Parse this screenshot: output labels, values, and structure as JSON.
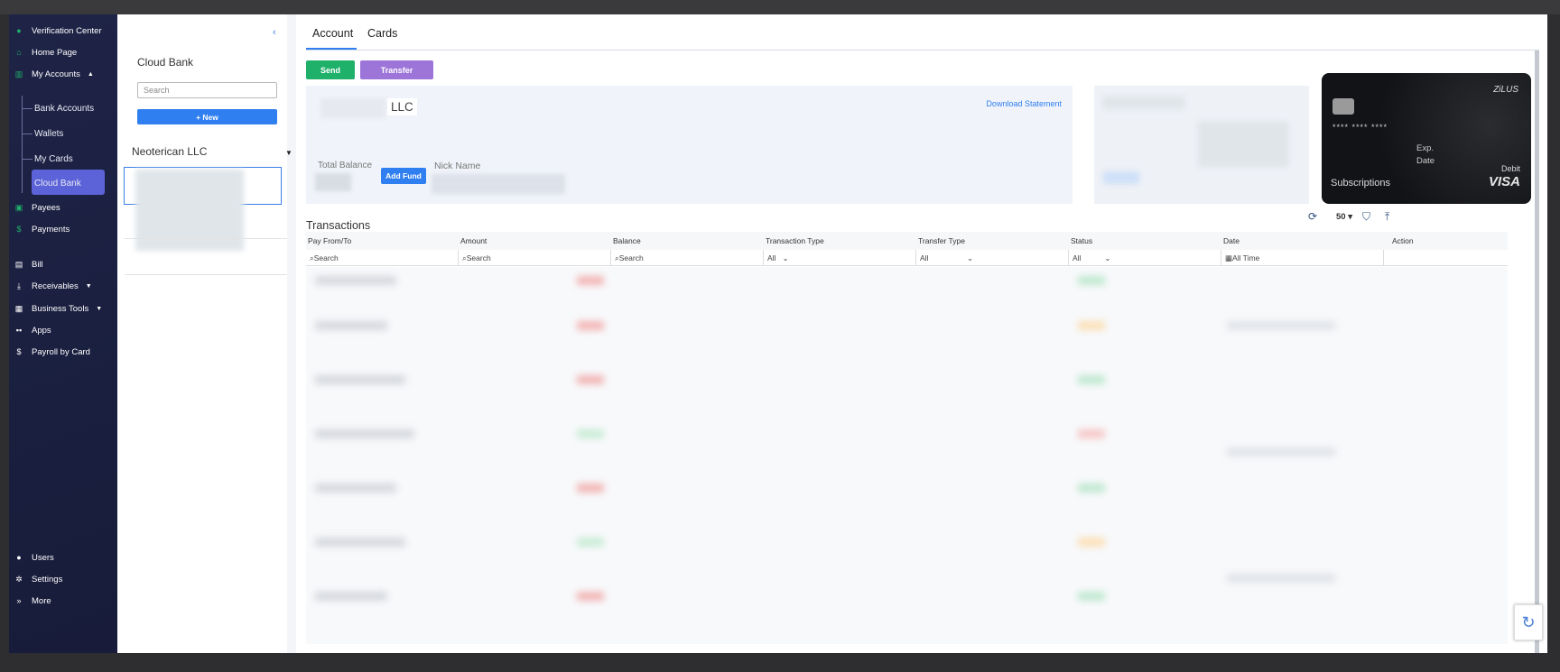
{
  "sidebar": {
    "top_items": [
      {
        "label": "Verification Center",
        "icon": "check-circle-icon"
      },
      {
        "label": "Home Page",
        "icon": "home-icon"
      },
      {
        "label": "My Accounts",
        "icon": "bank-icon"
      }
    ],
    "sub_items": [
      "Bank Accounts",
      "Wallets",
      "My Cards",
      "Cloud Bank"
    ],
    "mid_items": [
      {
        "label": "Payees",
        "icon": "payees-icon"
      },
      {
        "label": "Payments",
        "icon": "dollar-icon"
      },
      {
        "label": "Bill",
        "icon": "bill-icon"
      },
      {
        "label": "Receivables",
        "icon": "receivables-icon"
      },
      {
        "label": "Business Tools",
        "icon": "briefcase-icon"
      },
      {
        "label": "Apps",
        "icon": "apps-icon"
      },
      {
        "label": "Payroll by Card",
        "icon": "dollar-icon"
      }
    ],
    "bottom_items": [
      {
        "label": "Users",
        "icon": "user-icon"
      },
      {
        "label": "Settings",
        "icon": "gear-icon"
      },
      {
        "label": "More",
        "icon": "chevrons-right-icon"
      }
    ]
  },
  "panel": {
    "title": "Cloud Bank",
    "search_placeholder": "Search",
    "new_label": "+ New",
    "group_name": "Neoterican LLC"
  },
  "main": {
    "tabs": [
      "Account",
      "Cards"
    ],
    "send_label": "Send",
    "transfer_label": "Transfer",
    "account_name": "LLC",
    "download_label": "Download Statement",
    "total_balance_label": "Total Balance",
    "add_fund_label": "Add Fund",
    "nick_name_label": "Nick Name",
    "card": {
      "brand": "ZiLUS",
      "number": "**** **** ****",
      "exp_label": "Exp.",
      "date_label": "Date",
      "type": "Debit",
      "network": "VISA",
      "name": "Subscriptions"
    },
    "transactions_title": "Transactions",
    "page_size": "50",
    "columns": [
      "Pay From/To",
      "Amount",
      "Balance",
      "Transaction Type",
      "Transfer Type",
      "Status",
      "Date",
      "Action"
    ],
    "filters": {
      "search": "Search",
      "all": "All",
      "all_time": "All Time"
    }
  }
}
